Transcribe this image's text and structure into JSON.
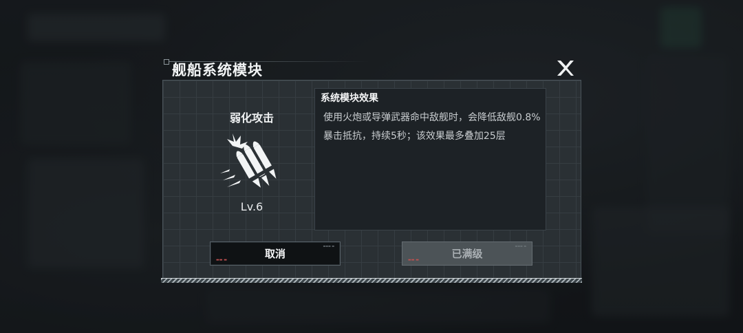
{
  "dialog": {
    "title": "舰船系统模块",
    "close_icon": "close-x-icon"
  },
  "module": {
    "name": "弱化攻击",
    "icon": "missile-volley-icon",
    "level": "Lv.6"
  },
  "effect": {
    "heading": "系统模块效果",
    "description": "使用火炮或导弹武器命中敌舰时，会降低敌舰0.8%暴击抵抗，持续5秒；该效果最多叠加25层"
  },
  "buttons": {
    "cancel_label": "取消",
    "max_level_label": "已满级"
  },
  "colors": {
    "panel_bg": "#2a3034",
    "effect_bg": "#1d2226",
    "cancel_bg": "#0f1214",
    "disabled_bg": "#4c5357"
  }
}
